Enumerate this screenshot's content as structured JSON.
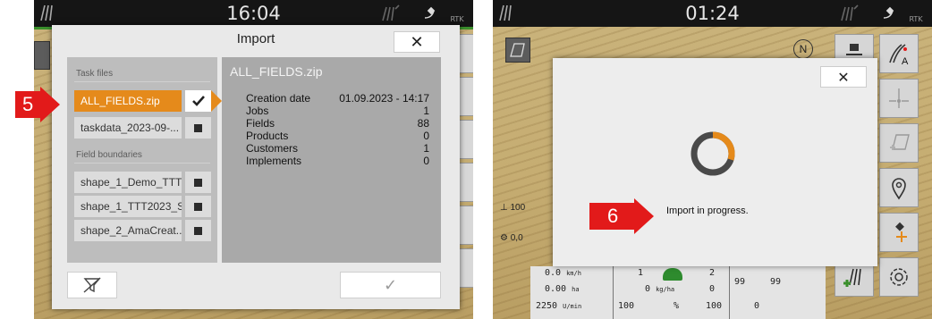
{
  "left_screen": {
    "clock": "16:04",
    "rtk": "RTK",
    "dialog": {
      "title": "Import",
      "close_glyph": "✕",
      "task_files_header": "Task files",
      "task_files": [
        {
          "name": "ALL_FIELDS.zip",
          "selected": true
        },
        {
          "name": "taskdata_2023-09-...",
          "selected": false
        }
      ],
      "field_boundaries_header": "Field boundaries",
      "field_boundaries": [
        {
          "name": "shape_1_Demo_TTT"
        },
        {
          "name": "shape_1_TTT2023_S..."
        },
        {
          "name": "shape_2_AmaCreat..."
        }
      ],
      "detail": {
        "title": "ALL_FIELDS.zip",
        "rows": [
          {
            "label": "Creation date",
            "value": "01.09.2023 - 14:17"
          },
          {
            "label": "Jobs",
            "value": "1"
          },
          {
            "label": "Fields",
            "value": "88"
          },
          {
            "label": "Products",
            "value": "0"
          },
          {
            "label": "Customers",
            "value": "1"
          },
          {
            "label": "Implements",
            "value": "0"
          }
        ]
      },
      "check_glyph": "✓"
    },
    "step_number": "5"
  },
  "right_screen": {
    "clock": "01:24",
    "rtk": "RTK",
    "compass": "N",
    "dialog": {
      "close_glyph": "✕",
      "progress_text": "Import in progress.",
      "spinner_fraction": 0.3
    },
    "step_number": "6",
    "readouts": {
      "left_top": "100",
      "left_bottom": "0,0"
    },
    "status": {
      "speed": "0.0",
      "speed_unit": "km/h",
      "area": "0.00",
      "area_unit": "ha",
      "rpm": "2250",
      "rpm_unit": "U/min",
      "sec1": "1",
      "sec2": "2",
      "rate": "0",
      "rate_unit": "kg/ha",
      "rate2": "0",
      "pct1": "100",
      "pct_unit": "%",
      "pct2": "100",
      "bin1": "99",
      "bin2": "99",
      "bin3": "0"
    },
    "colors": {
      "accent": "#e58a1b",
      "callout": "#e21a1a",
      "spinner": "#e58a1b"
    }
  }
}
